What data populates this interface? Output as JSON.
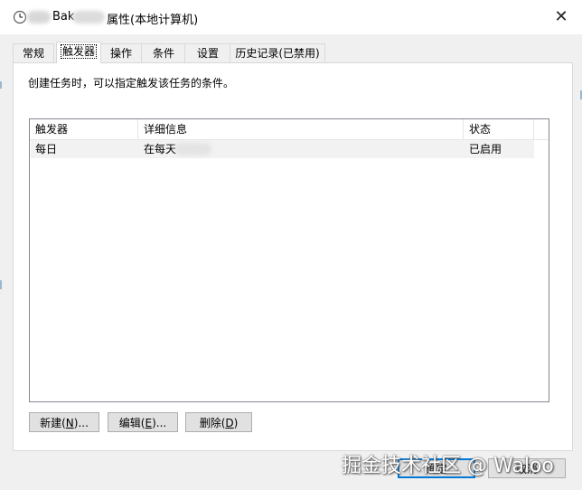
{
  "window": {
    "title_prefix": "Bak",
    "title_suffix": "属性(本地计算机)",
    "close_glyph": "✕"
  },
  "tabs": [
    {
      "label": "常规"
    },
    {
      "label": "触发器"
    },
    {
      "label": "操作"
    },
    {
      "label": "条件"
    },
    {
      "label": "设置"
    },
    {
      "label": "历史记录(已禁用)"
    }
  ],
  "triggers_panel": {
    "description": "创建任务时，可以指定触发该任务的条件。",
    "columns": [
      "触发器",
      "详细信息",
      "状态"
    ],
    "rows": [
      {
        "trigger": "每日",
        "details": "在每天",
        "status": "已启用"
      }
    ]
  },
  "buttons": {
    "new_label_a": "新建(",
    "new_label_key": "N",
    "new_label_b": ")...",
    "edit_label_a": "编辑(",
    "edit_label_key": "E",
    "edit_label_b": ")...",
    "delete_label_a": "删除(",
    "delete_label_key": "D",
    "delete_label_b": ")",
    "ok_label": "确定",
    "cancel_label": "取消"
  },
  "watermark": "掘金技术社区 @ Waloo",
  "colors": {
    "dialog_bg": "#f0f0f0",
    "focus_blue": "#0078d7"
  }
}
